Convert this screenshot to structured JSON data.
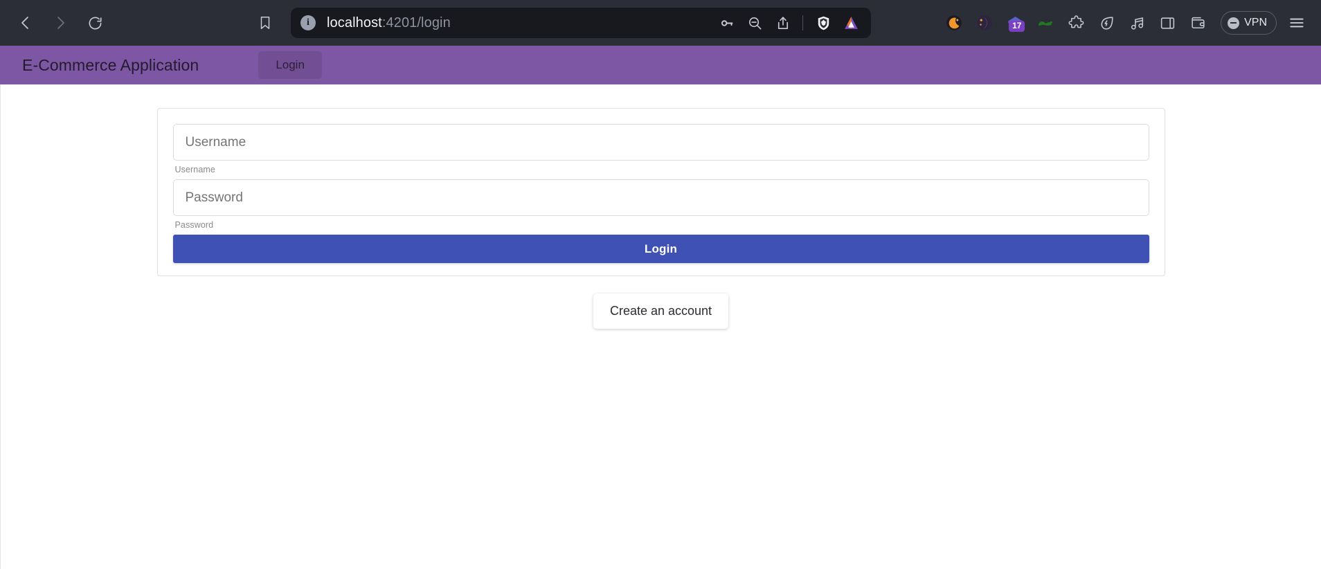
{
  "browser": {
    "nav": {
      "back": "back-arrow",
      "forward": "forward-arrow",
      "reload": "reload"
    },
    "bookmark_label": "bookmark",
    "url": {
      "host": "localhost",
      "rest": ":4201/login",
      "full": "localhost:4201/login",
      "site_info_glyph": "i"
    },
    "url_actions": [
      "password-key",
      "zoom-out",
      "share"
    ],
    "extensions": [
      {
        "name": "brave-shields",
        "glyph": "lion"
      },
      {
        "name": "brave-rewards",
        "glyph": "triangle"
      },
      {
        "name": "dark-reader",
        "glyph": "moon"
      },
      {
        "name": "crescent-extension",
        "glyph": "crescent"
      },
      {
        "name": "purple-diamond-extension",
        "glyph": "diamond",
        "badge": "17"
      },
      {
        "name": "green-extension",
        "glyph": "caterpillar"
      },
      {
        "name": "extensions-puzzle",
        "glyph": "puzzle"
      },
      {
        "name": "leaf-bolt-extension",
        "glyph": "leaf"
      },
      {
        "name": "music-extension",
        "glyph": "music"
      },
      {
        "name": "sidebar-toggle",
        "glyph": "panel"
      },
      {
        "name": "wallet",
        "glyph": "wallet"
      }
    ],
    "vpn_label": "VPN",
    "menu_label": "browser-menu"
  },
  "app": {
    "title": "E-Commerce Application",
    "header_login_label": "Login"
  },
  "form": {
    "username": {
      "placeholder": "Username",
      "value": "",
      "hint": "Username"
    },
    "password": {
      "placeholder": "Password",
      "value": "",
      "hint": "Password"
    },
    "submit_label": "Login",
    "create_account_label": "Create an account"
  },
  "colors": {
    "chrome_bg": "#2b2e37",
    "urlbar_bg": "#17191f",
    "app_header": "#7e57a4",
    "primary_button": "#3f51b5",
    "page_bg": "#ffffff"
  }
}
